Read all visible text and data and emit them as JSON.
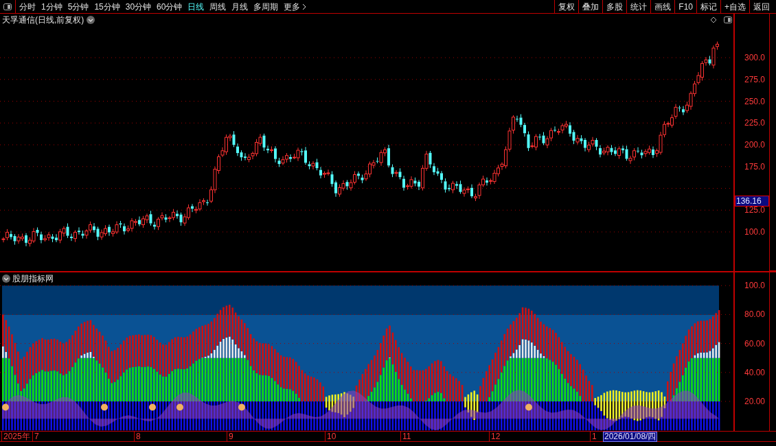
{
  "toolbar": {
    "periods": [
      {
        "label": "分时",
        "selected": false
      },
      {
        "label": "1分钟",
        "selected": false
      },
      {
        "label": "5分钟",
        "selected": false
      },
      {
        "label": "15分钟",
        "selected": false
      },
      {
        "label": "30分钟",
        "selected": false
      },
      {
        "label": "60分钟",
        "selected": false
      },
      {
        "label": "日线",
        "selected": true
      },
      {
        "label": "周线",
        "selected": false
      },
      {
        "label": "月线",
        "selected": false
      },
      {
        "label": "多周期",
        "selected": false
      }
    ],
    "more": "更多",
    "actions": [
      "复权",
      "叠加",
      "多股",
      "统计",
      "画线",
      "F10",
      "标记",
      "+自选",
      "返回"
    ]
  },
  "main_chart": {
    "title": "天孚通信(日线,前复权)",
    "price_ticks": [
      "300.0",
      "275.0",
      "250.0",
      "225.0",
      "200.0",
      "175.0",
      "125.0",
      "100.0"
    ],
    "current_price": "136.16"
  },
  "indicator": {
    "title": "股朋指标网",
    "ticks": [
      "100.0",
      "80.00",
      "60.00",
      "40.00",
      "20.00"
    ]
  },
  "date_axis": {
    "labels": [
      "2025年",
      "7",
      "8",
      "9",
      "10",
      "11",
      "12",
      "1"
    ],
    "cursor_date": "2026/01/08/四"
  }
}
